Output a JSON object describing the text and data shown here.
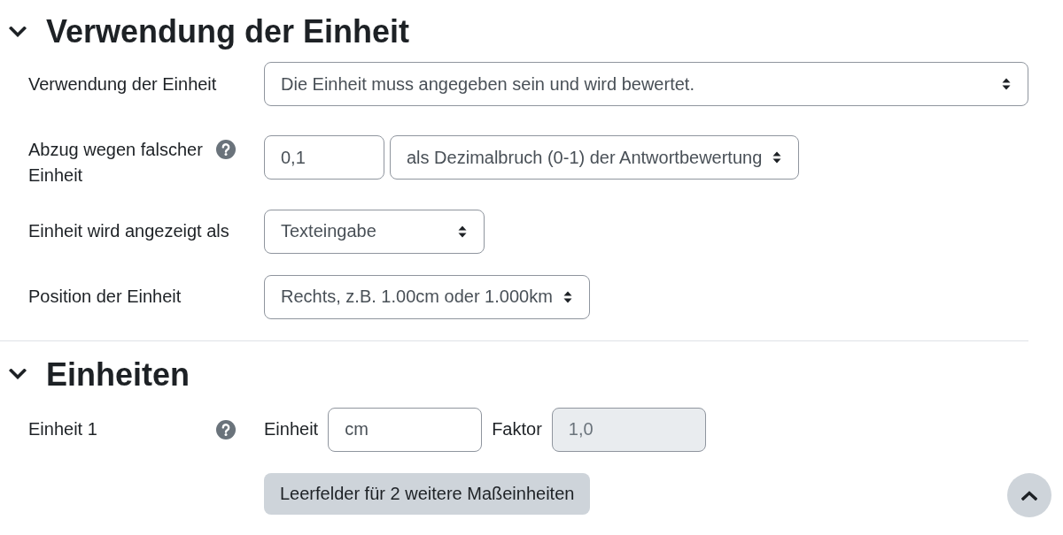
{
  "sections": [
    {
      "title": "Verwendung der Einheit",
      "expanded": true,
      "rows": [
        {
          "label": "Verwendung der Einheit",
          "has_help": false,
          "controls": [
            {
              "kind": "select",
              "value": "Die Einheit muss angegeben sein und wird bewertet."
            }
          ]
        },
        {
          "label": "Abzug wegen falscher Einheit",
          "has_help": true,
          "controls": [
            {
              "kind": "input",
              "value": "0,1",
              "disabled": false
            },
            {
              "kind": "select",
              "value": "als Dezimalbruch (0-1) der Antwortbewertung"
            }
          ]
        },
        {
          "label": "Einheit wird angezeigt als",
          "has_help": false,
          "controls": [
            {
              "kind": "select",
              "value": "Texteingabe"
            }
          ]
        },
        {
          "label": "Position der Einheit",
          "has_help": false,
          "controls": [
            {
              "kind": "select",
              "value": "Rechts, z.B. 1.00cm oder 1.000km"
            }
          ]
        }
      ]
    },
    {
      "title": "Einheiten",
      "expanded": true,
      "rows": [
        {
          "label": "Einheit 1",
          "has_help": true,
          "controls": [
            {
              "kind": "text",
              "text": "Einheit"
            },
            {
              "kind": "input",
              "value": "cm",
              "disabled": false
            },
            {
              "kind": "text",
              "text": "Faktor"
            },
            {
              "kind": "input",
              "value": "1,0",
              "disabled": true
            }
          ]
        },
        {
          "has_help": false,
          "controls": [
            {
              "kind": "button",
              "label": "Leerfelder für 2 weitere Maßeinheiten"
            }
          ]
        }
      ]
    }
  ],
  "back_to_top": true
}
